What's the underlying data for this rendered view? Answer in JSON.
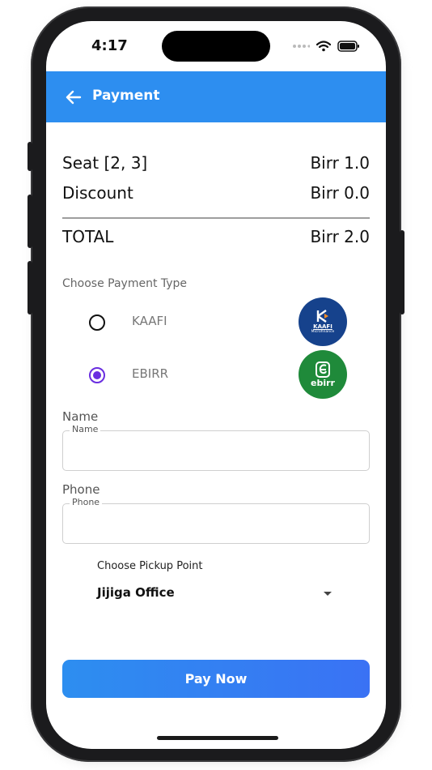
{
  "status_bar": {
    "time": "4:17"
  },
  "appbar": {
    "title": "Payment"
  },
  "summary": {
    "seat_label": "Seat [2, 3]",
    "seat_value": "Birr 1.0",
    "discount_label": "Discount",
    "discount_value": "Birr 0.0",
    "total_label": "TOTAL",
    "total_value": "Birr 2.0"
  },
  "payment": {
    "section_label": "Choose Payment Type",
    "options": [
      {
        "label": "KAAFI",
        "selected": false,
        "logo_text": "KAAFI",
        "logo_subtext": "Microfinance",
        "logo_color": "#16428c"
      },
      {
        "label": "EBIRR",
        "selected": true,
        "logo_text": "ebirr",
        "logo_color": "#1f8a3a"
      }
    ]
  },
  "form": {
    "name_label": "Name",
    "name_float_label": "Name",
    "name_value": "",
    "phone_label": "Phone",
    "phone_float_label": "Phone",
    "phone_value": ""
  },
  "pickup": {
    "label": "Choose Pickup Point",
    "selected": "Jijiga Office"
  },
  "actions": {
    "pay_now": "Pay Now"
  },
  "colors": {
    "primary": "#2d8ef0",
    "radio_selected": "#6a2ee0"
  }
}
